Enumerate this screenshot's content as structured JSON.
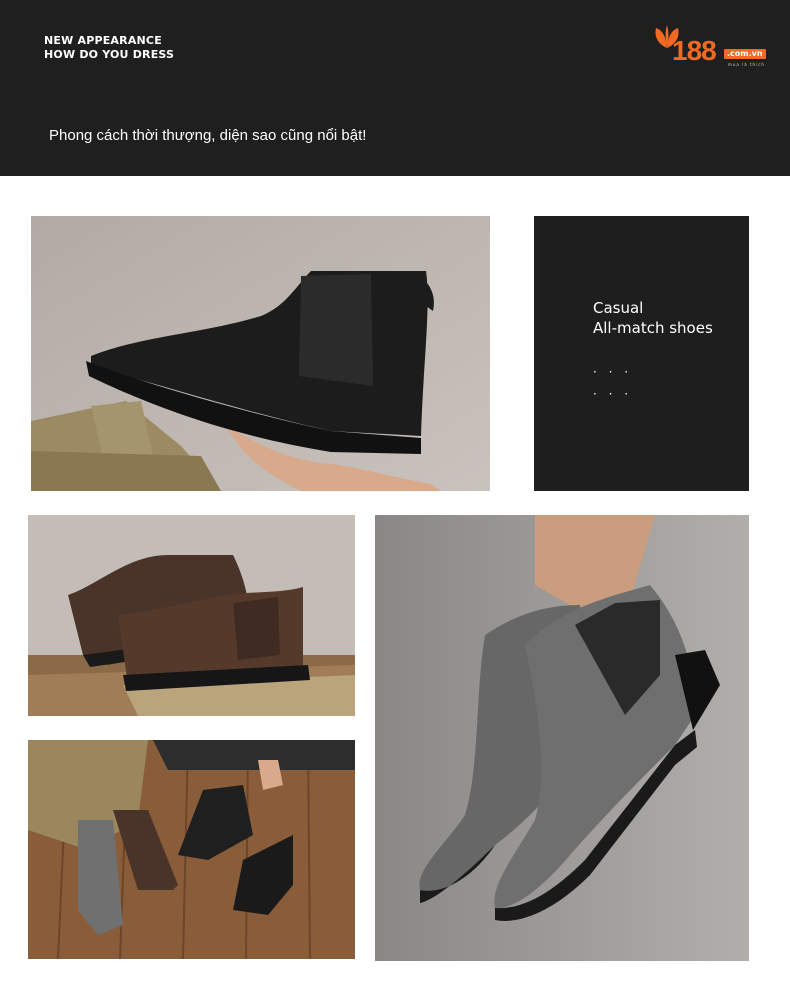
{
  "header": {
    "line1": "NEW APPEARANCE",
    "line2": "HOW DO YOU DRESS",
    "tagline": "Phong cách thời thượng, diện sao cũng nổi bật!"
  },
  "logo": {
    "number": "188",
    "domain": ".com.vn",
    "sub": "mua là thích",
    "icon": "leaf-icon",
    "color": "#f06a23"
  },
  "card": {
    "line1": "Casual",
    "line2": "All-match shoes",
    "dots1": "· · ·",
    "dots2": "· · ·"
  },
  "photos": [
    {
      "name": "black-suede-chelsea-boot-in-hand",
      "boot_color": "#1c1c1c"
    },
    {
      "name": "brown-suede-chelsea-boots-pair",
      "boot_color": "#4a3328"
    },
    {
      "name": "boots-worn-on-wooden-floor",
      "boot_color": "#2a2a2a"
    },
    {
      "name": "grey-suede-chelsea-boots-held",
      "boot_color": "#6b6b6b"
    }
  ]
}
